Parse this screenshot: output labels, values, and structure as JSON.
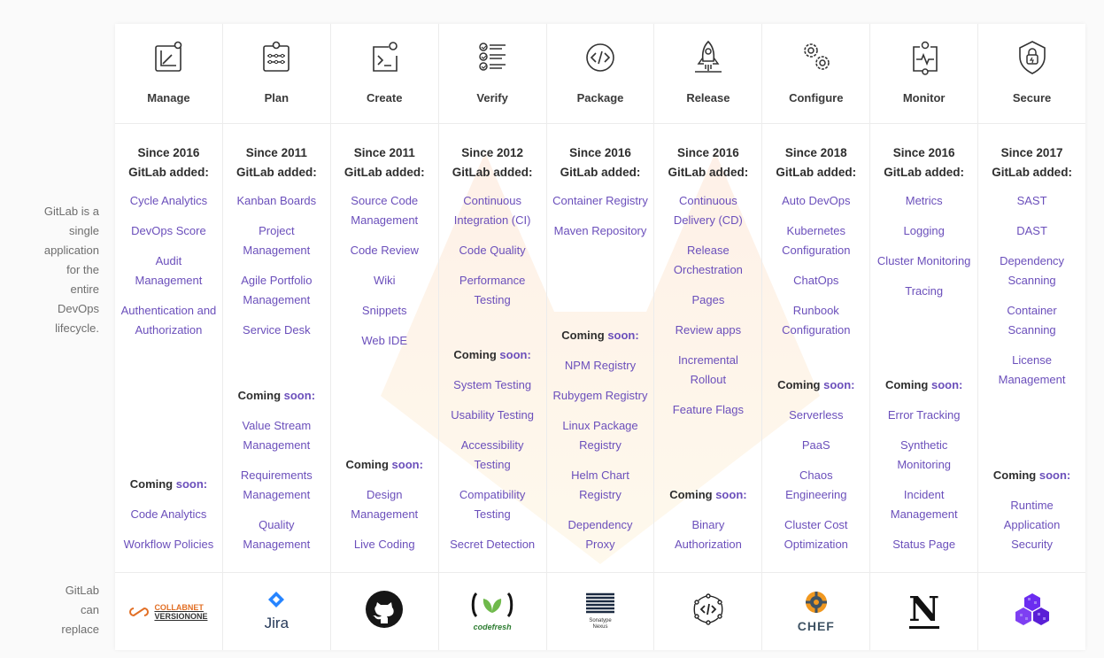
{
  "side": {
    "top": [
      "GitLab is a",
      "single",
      "application",
      "for the",
      "entire",
      "DevOps",
      "lifecycle."
    ],
    "bottom": [
      "GitLab",
      "can",
      "replace"
    ]
  },
  "labels": {
    "coming": "Coming",
    "soon": "soon:"
  },
  "columns": [
    {
      "stage": "Manage",
      "icon": "manage-icon",
      "since": "Since 2016",
      "added": "GitLab added:",
      "features": [
        "Cycle Analytics",
        "DevOps Score",
        "Audit Management",
        "Authentication and Authorization"
      ],
      "coming": [
        "Code Analytics",
        "Workflow Policies"
      ],
      "replace": "CollabNet VersionOne",
      "replace_lines": [
        "COLLABNET",
        "VERSIONONE"
      ]
    },
    {
      "stage": "Plan",
      "icon": "plan-icon",
      "since": "Since 2011",
      "added": "GitLab added:",
      "features": [
        "Kanban Boards",
        "Project Management",
        "Agile Portfolio Management",
        "Service Desk"
      ],
      "coming": [
        "Value Stream Management",
        "Requirements Management",
        "Quality Management"
      ],
      "replace": "Jira",
      "replace_lines": [
        "Jira"
      ]
    },
    {
      "stage": "Create",
      "icon": "create-icon",
      "since": "Since 2011",
      "added": "GitLab added:",
      "features": [
        "Source Code Management",
        "Code Review",
        "Wiki",
        "Snippets",
        "Web IDE"
      ],
      "coming": [
        "Design Management",
        "Live Coding"
      ],
      "replace": "GitHub",
      "replace_lines": []
    },
    {
      "stage": "Verify",
      "icon": "verify-icon",
      "since": "Since 2012",
      "added": "GitLab added:",
      "features": [
        "Continuous Integration (CI)",
        "Code Quality",
        "Performance Testing"
      ],
      "coming": [
        "System Testing",
        "Usability Testing",
        "Accessibility Testing",
        "Compatibility Testing",
        "Secret Detection"
      ],
      "replace": "codefresh",
      "replace_lines": [
        "codefresh"
      ]
    },
    {
      "stage": "Package",
      "icon": "package-icon",
      "since": "Since 2016",
      "added": "GitLab added:",
      "features": [
        "Container Registry",
        "Maven Repository"
      ],
      "coming": [
        "NPM Registry",
        "Rubygem Registry",
        "Linux Package Registry",
        "Helm Chart Registry",
        "Dependency Proxy"
      ],
      "replace": "Sonatype Nexus",
      "replace_lines": [
        "Sonatype",
        "Nexus"
      ]
    },
    {
      "stage": "Release",
      "icon": "release-icon",
      "since": "Since 2016",
      "added": "GitLab added:",
      "features": [
        "Continuous Delivery (CD)",
        "Release Orchestration",
        "Pages",
        "Review apps",
        "Incremental Rollout",
        "Feature Flags"
      ],
      "coming": [
        "Binary Authorization"
      ],
      "replace": "Spinnaker",
      "replace_lines": []
    },
    {
      "stage": "Configure",
      "icon": "configure-icon",
      "since": "Since 2018",
      "added": "GitLab added:",
      "features": [
        "Auto DevOps",
        "Kubernetes Configuration",
        "ChatOps",
        "Runbook Configuration"
      ],
      "coming": [
        "Serverless",
        "PaaS",
        "Chaos Engineering",
        "Cluster Cost Optimization"
      ],
      "replace": "CHEF",
      "replace_lines": [
        "CHEF"
      ]
    },
    {
      "stage": "Monitor",
      "icon": "monitor-icon",
      "since": "Since 2016",
      "added": "GitLab added:",
      "features": [
        "Metrics",
        "Logging",
        "Cluster Monitoring",
        "Tracing"
      ],
      "coming": [
        "Error Tracking",
        "Synthetic Monitoring",
        "Incident Management",
        "Status Page"
      ],
      "replace": "New Relic",
      "replace_lines": [
        "N"
      ]
    },
    {
      "stage": "Secure",
      "icon": "secure-icon",
      "since": "Since 2017",
      "added": "GitLab added:",
      "features": [
        "SAST",
        "DAST",
        "Dependency Scanning",
        "Container Scanning",
        "License Management"
      ],
      "coming": [
        "Runtime Application Security"
      ],
      "replace": "Snyk",
      "replace_lines": []
    }
  ],
  "colors": {
    "feature": "#6b4fbb",
    "text": "#2e2e2e",
    "muted": "#6e6e6e",
    "divider": "#ececec"
  }
}
